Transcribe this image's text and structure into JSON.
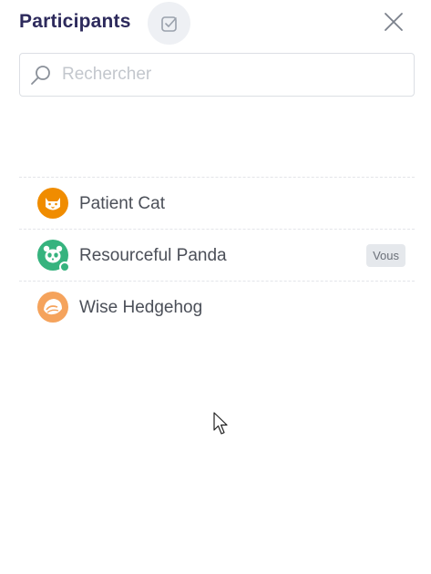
{
  "header": {
    "title": "Participants",
    "action_icon": "check-square-icon",
    "close_icon": "close-icon"
  },
  "search": {
    "placeholder": "Rechercher",
    "value": "",
    "icon": "search-icon"
  },
  "participants": [
    {
      "name": "Patient Cat",
      "avatar": "cat-avatar-icon",
      "color": "#f08c00",
      "badge": "",
      "online": false
    },
    {
      "name": "Resourceful Panda",
      "avatar": "panda-avatar-icon",
      "color": "#36b37e",
      "badge": "Vous",
      "online": true
    },
    {
      "name": "Wise Hedgehog",
      "avatar": "hedgehog-avatar-icon",
      "color": "#f5a35c",
      "badge": "",
      "online": false
    }
  ],
  "colors": {
    "title": "#2d2a5c",
    "text": "#4b4f58",
    "divider": "#e3e5e9"
  }
}
